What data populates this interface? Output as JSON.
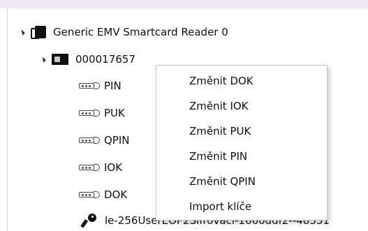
{
  "tree": {
    "reader_label": "Generic EMV Smartcard Reader 0",
    "card_label": "000017657",
    "items": [
      {
        "label": "PIN"
      },
      {
        "label": "PUK"
      },
      {
        "label": "QPIN"
      },
      {
        "label": "IOK"
      },
      {
        "label": "DOK"
      }
    ],
    "key_label": "le-256UserEOP2Sifrovaci-1666ddf2--48331"
  },
  "context_menu": {
    "items": [
      {
        "label": "Změnit DOK"
      },
      {
        "label": "Změnit IOK"
      },
      {
        "label": "Změnit PUK"
      },
      {
        "label": "Změnit PIN"
      },
      {
        "label": "Změnit QPIN"
      },
      {
        "label": "Import klíče"
      }
    ]
  }
}
